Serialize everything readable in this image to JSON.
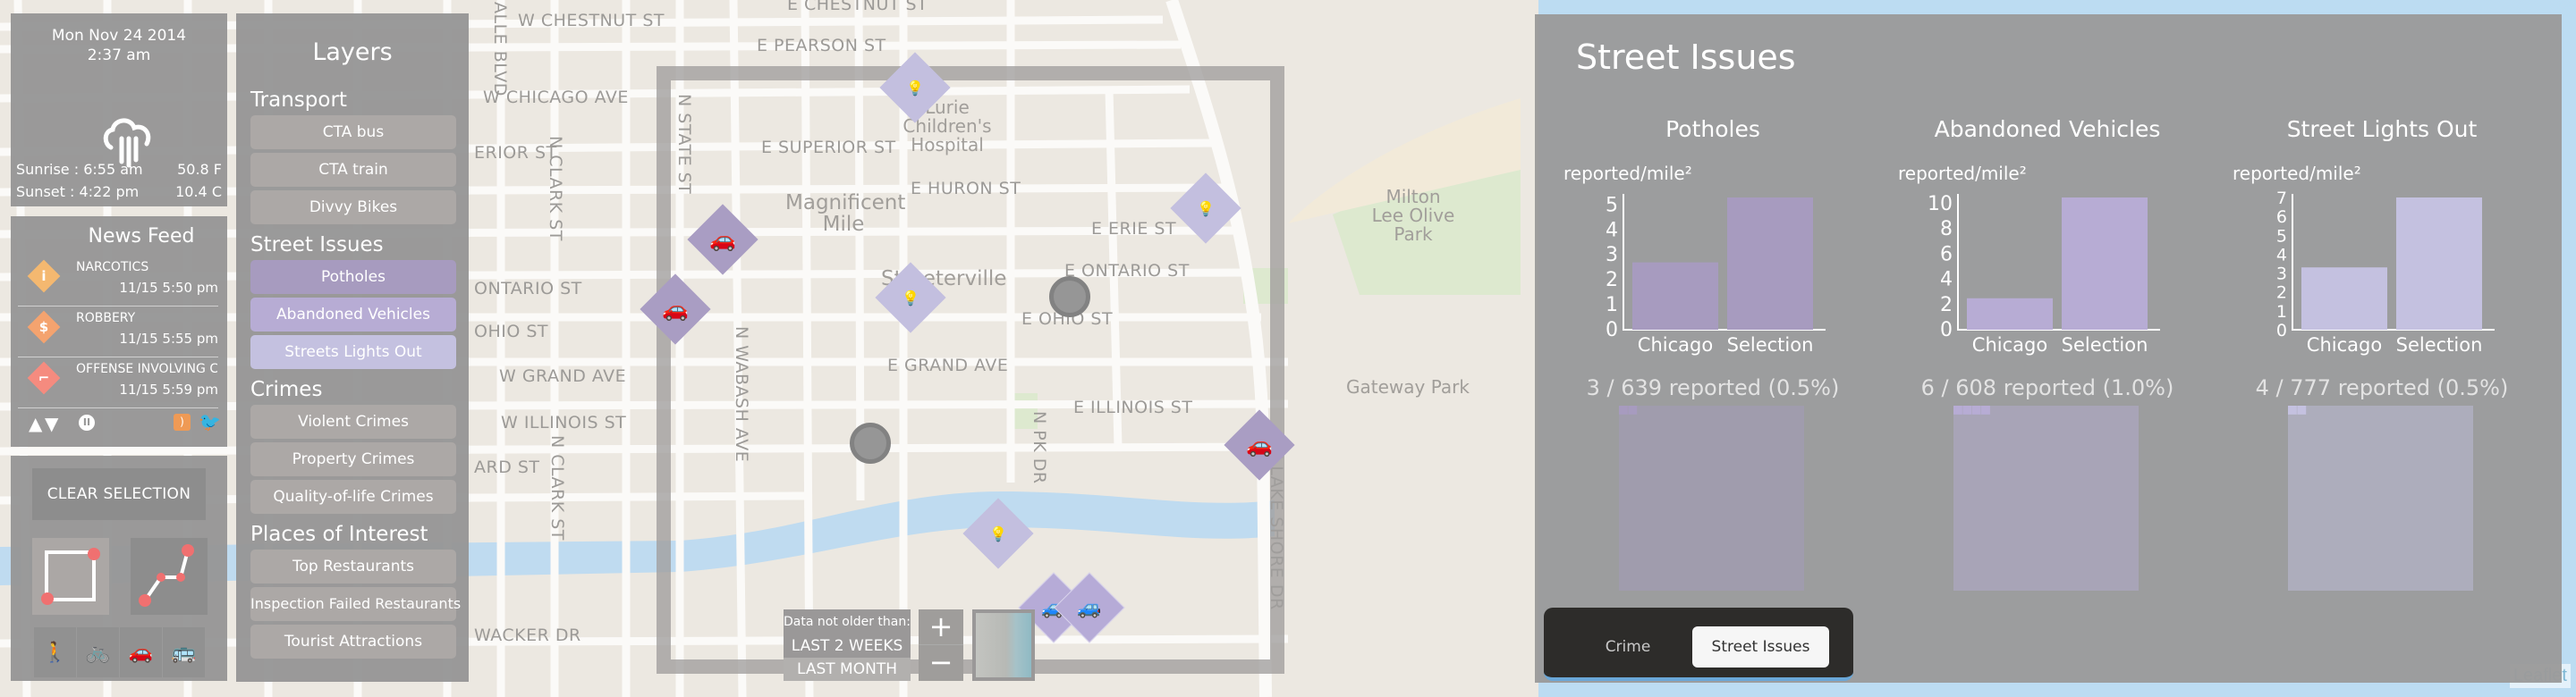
{
  "weather": {
    "date": "Mon Nov 24 2014",
    "time": "2:37 am",
    "icon": "rain-cloud-icon",
    "sunrise": "Sunrise : 6:55 am",
    "sunset": "Sunset : 4:22 pm",
    "temp_f": "50.8 F",
    "temp_c": "10.4 C"
  },
  "news": {
    "title": "News Feed",
    "items": [
      {
        "label": "NARCOTICS",
        "time": "11/15 5:50 pm",
        "icon": "syringe-icon",
        "color": "#f4b870"
      },
      {
        "label": "ROBBERY",
        "time": "11/15 5:55 pm",
        "icon": "money-bag-icon",
        "color": "#f4a36f"
      },
      {
        "label": "OFFENSE INVOLVING CHILDREN",
        "time": "11/15 5:59 pm",
        "icon": "gun-icon",
        "color": "#f58b7f"
      }
    ],
    "rss_color": "#ef9a55",
    "twitter_color": "#55acee"
  },
  "selection": {
    "clear_label": "CLEAR SELECTION",
    "tools": [
      "rectangle-select",
      "polyline-select"
    ],
    "modes": [
      "walk",
      "bike",
      "car",
      "bus"
    ],
    "accent": "#f07070"
  },
  "layers": {
    "title": "Layers",
    "sections": [
      {
        "title": "Transport",
        "items": [
          "CTA bus",
          "CTA train",
          "Divvy Bikes"
        ]
      },
      {
        "title": "Street Issues",
        "items": [
          "Potholes",
          "Abandoned Vehicles",
          "Streets Lights Out"
        ]
      },
      {
        "title": "Crimes",
        "items": [
          "Violent Crimes",
          "Property Crimes",
          "Quality-of-life Crimes"
        ]
      },
      {
        "title": "Places of Interest",
        "items": [
          "Top Restaurants",
          "Inspection Failed Restaurants",
          "Tourist Attractions"
        ]
      }
    ]
  },
  "map": {
    "streets": {
      "w_chestnut": "W CHESTNUT ST",
      "e_chestnut": "E CHESTNUT ST",
      "e_pearson": "E PEARSON ST",
      "w_chicago": "W CHICAGO AVE",
      "e_superior": "E SUPERIOR ST",
      "w_superior": "ERIOR ST",
      "e_huron": "E HURON ST",
      "e_erie": "E ERIE ST",
      "e_ontario": "E ONTARIO ST",
      "w_ontario": "ONTARIO ST",
      "e_ohio": "E OHIO ST",
      "w_ohio": "OHIO ST",
      "e_grand": "E GRAND AVE",
      "w_grand": "W GRAND AVE",
      "e_illinois": "E ILLINOIS ST",
      "w_illinois": "W ILLINOIS ST",
      "hubbard": "ARD ST",
      "wacker": "WACKER DR",
      "lasalle": "ALLE BLVD",
      "n_clark_1": "N CLARK ST",
      "n_clark_2": "N CLARK ST",
      "n_state": "N STATE ST",
      "n_wabash": "N WABASH AVE",
      "n_pk": "N PK DR",
      "lake_shore": "N LAKE SHORE DR"
    },
    "places": {
      "childrens": "Lurie Children's Hospital",
      "mag_mile": "Magnificent Mile",
      "streeterville": "Streeterville",
      "milton": "Milton Lee Olive Park",
      "gateway": "Gateway Park"
    },
    "age_filter": {
      "label": "Data not older than:",
      "options": [
        "LAST 2 WEEKS",
        "LAST MONTH"
      ],
      "selected": "LAST MONTH"
    },
    "zoom_in": "+",
    "zoom_out": "−",
    "attribution": "Leaflet"
  },
  "issues_panel": {
    "title": "Street Issues",
    "unit_label": "reported/mile²",
    "tabs": [
      {
        "label": "Crime",
        "active": false
      },
      {
        "label": "Street Issues",
        "active": true
      }
    ]
  },
  "chart_data": [
    {
      "type": "bar",
      "title": "Potholes",
      "ylabel": "reported/mile²",
      "categories": [
        "Chicago",
        "Selection"
      ],
      "values": [
        2.7,
        5.3
      ],
      "ylim": [
        0,
        5.3
      ],
      "yticks": [
        0,
        1,
        2,
        3,
        4,
        5
      ],
      "color": "#a79bbf",
      "selected": 3,
      "total": 639,
      "stat_label": "3 / 639 reported (0.5%)"
    },
    {
      "type": "bar",
      "title": "Abandoned Vehicles",
      "ylabel": "reported/mile²",
      "categories": [
        "Chicago",
        "Selection"
      ],
      "values": [
        2.5,
        10.5
      ],
      "ylim": [
        0,
        10.5
      ],
      "yticks": [
        0,
        2,
        4,
        6,
        8,
        10
      ],
      "color": "#b7acd4",
      "selected": 6,
      "total": 608,
      "stat_label": "6 / 608 reported (1.0%)"
    },
    {
      "type": "bar",
      "title": "Street Lights Out",
      "ylabel": "reported/mile²",
      "categories": [
        "Chicago",
        "Selection"
      ],
      "values": [
        3.3,
        7.0
      ],
      "ylim": [
        0,
        7.0
      ],
      "yticks": [
        0,
        1,
        2,
        3,
        4,
        5,
        6,
        7
      ],
      "color": "#c4c1e0",
      "selected": 4,
      "total": 777,
      "stat_label": "4 / 777 reported (0.5%)"
    }
  ]
}
